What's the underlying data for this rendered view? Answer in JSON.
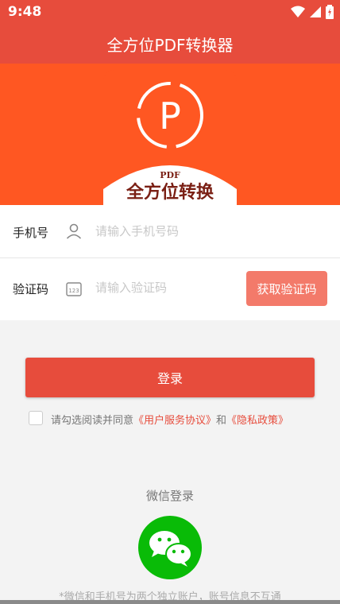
{
  "status": {
    "time": "9:48"
  },
  "app": {
    "title": "全方位PDF转换器"
  },
  "logo": {
    "badge_text": "PDF",
    "name": "全方位转换",
    "letter": "P"
  },
  "form": {
    "phone_label": "手机号",
    "phone_placeholder": "请输入手机号码",
    "code_label": "验证码",
    "code_placeholder": "请输入验证码",
    "get_code_label": "获取验证码"
  },
  "login": {
    "label": "登录"
  },
  "agreement": {
    "prefix": "请勾选阅读并同意",
    "user_agreement": "《用户服务协议》",
    "and": "和",
    "privacy": "《隐私政策》"
  },
  "wechat": {
    "title": "微信登录"
  },
  "note": "*微信和手机号为两个独立账户，账号信息不互通",
  "colors": {
    "primary": "#e74c3c",
    "banner": "#ff5722",
    "wechat": "#09bb07"
  }
}
